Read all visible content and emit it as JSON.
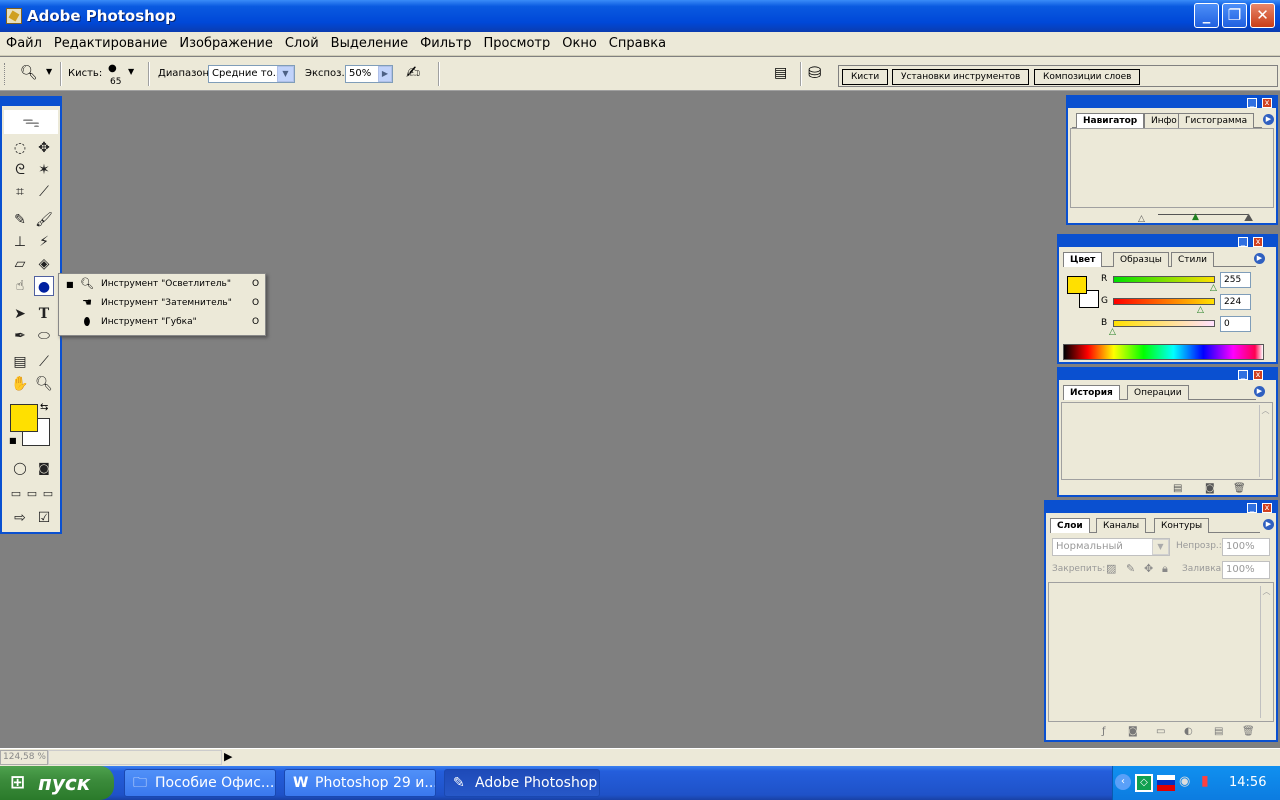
{
  "window": {
    "title": "Adobe Photoshop",
    "minimize_icon": "minimize-icon",
    "maximize_icon": "maximize-icon",
    "close_icon": "close-icon"
  },
  "menu": [
    "Файл",
    "Редактирование",
    "Изображение",
    "Слой",
    "Выделение",
    "Фильтр",
    "Просмотр",
    "Окно",
    "Справка"
  ],
  "options": {
    "brush_label": "Кисть:",
    "brush_size": "65",
    "range_label": "Диапазон:",
    "range_value": "Средние то...",
    "exposure_label": "Экспоз.:",
    "exposure_value": "50%"
  },
  "palette_well": {
    "tabs": [
      "Кисти",
      "Установки инструментов",
      "Композиции слоев"
    ]
  },
  "flyout": {
    "items": [
      {
        "label": "Инструмент \"Осветлитель\"",
        "key": "O",
        "selected": true
      },
      {
        "label": "Инструмент \"Затемнитель\"",
        "key": "O",
        "selected": false
      },
      {
        "label": "Инструмент \"Губка\"",
        "key": "O",
        "selected": false
      }
    ]
  },
  "colors": {
    "foreground": "#ffe000",
    "background": "#ffffff",
    "accent": "#0a50d0"
  },
  "navigator": {
    "tabs": [
      "Навигатор",
      "Инфо",
      "Гистограмма"
    ]
  },
  "color_panel": {
    "tabs": [
      "Цвет",
      "Образцы",
      "Стили"
    ],
    "r_label": "R",
    "g_label": "G",
    "b_label": "B",
    "r": "255",
    "g": "224",
    "b": "0"
  },
  "history": {
    "tabs": [
      "История",
      "Операции"
    ]
  },
  "layers": {
    "tabs": [
      "Слои",
      "Каналы",
      "Контуры"
    ],
    "blend_mode": "Нормальный",
    "opacity_label": "Непрозр.:",
    "opacity": "100%",
    "lock_label": "Закрепить:",
    "fill_label": "Заливка:",
    "fill": "100%"
  },
  "status": {
    "zoom": "124,58 %"
  },
  "taskbar": {
    "start": "пуск",
    "buttons": [
      "Пособие Офис...",
      "Photoshop 29 и...",
      "Adobe Photoshop"
    ],
    "clock": "14:56"
  }
}
